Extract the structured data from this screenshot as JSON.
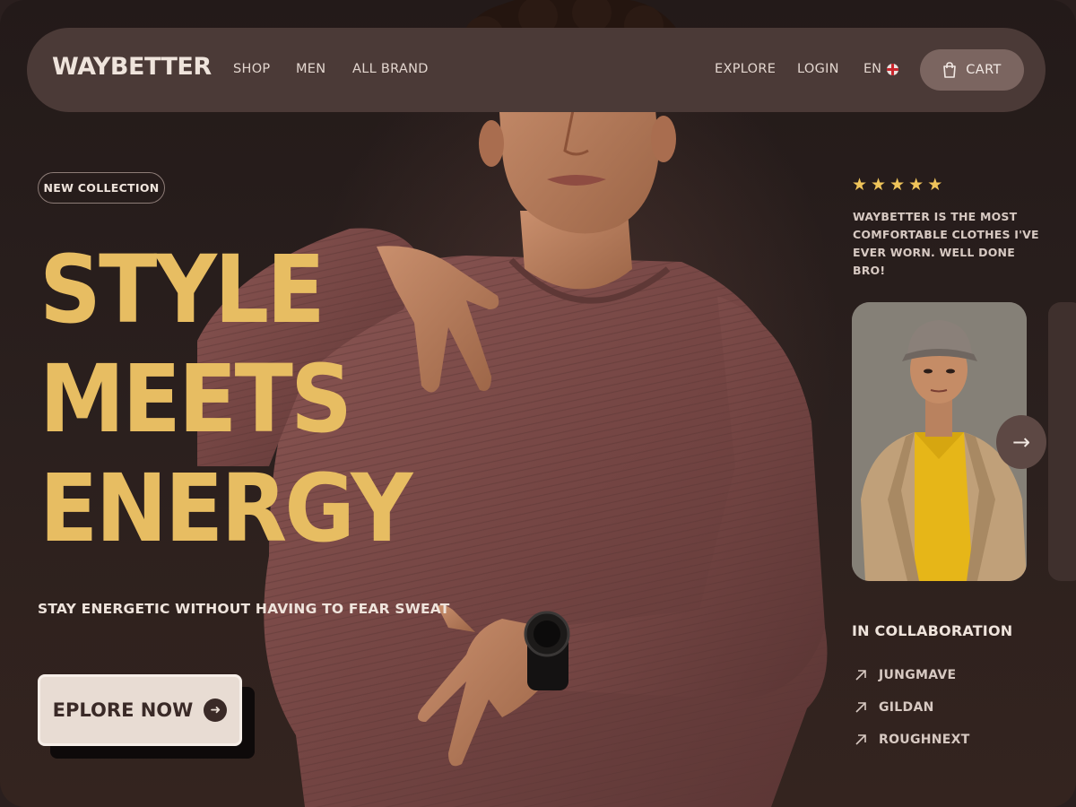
{
  "nav": {
    "logo": "WAYBETTER",
    "left_links": [
      "SHOP",
      "MEN",
      "ALL BRAND"
    ],
    "right_links": [
      "EXPLORE",
      "LOGIN"
    ],
    "language": "EN",
    "cart_label": "CART"
  },
  "hero": {
    "badge": "NEW COLLECTION",
    "headline": [
      "STYLE",
      "MEETS",
      "ENERGY"
    ],
    "subline": "STAY ENERGETIC WITHOUT HAVING TO FEAR SWEAT",
    "cta_label": "EPLORE NOW"
  },
  "review": {
    "rating": 5,
    "text": "WAYBETTER IS THE MOST COMFORTABLE CLOTHES I'VE EVER WORN. WELL DONE BRO!"
  },
  "collaboration": {
    "title": "IN COLLABORATION",
    "brands": [
      "JUNGMAVE",
      "GILDAN",
      "ROUGHNEXT"
    ]
  },
  "colors": {
    "accent": "#e7bd62",
    "background": "#2a1f1e",
    "nav_bg": "#4b3a37",
    "shirt": "#7a4a48",
    "star": "#efc45a"
  },
  "icons": {
    "cart": "shopping-bag-icon",
    "cta": "arrow-right-circle-icon",
    "carousel_next": "arrow-right-icon",
    "brand_link": "arrow-up-right-icon",
    "language": "uk-flag-icon"
  }
}
